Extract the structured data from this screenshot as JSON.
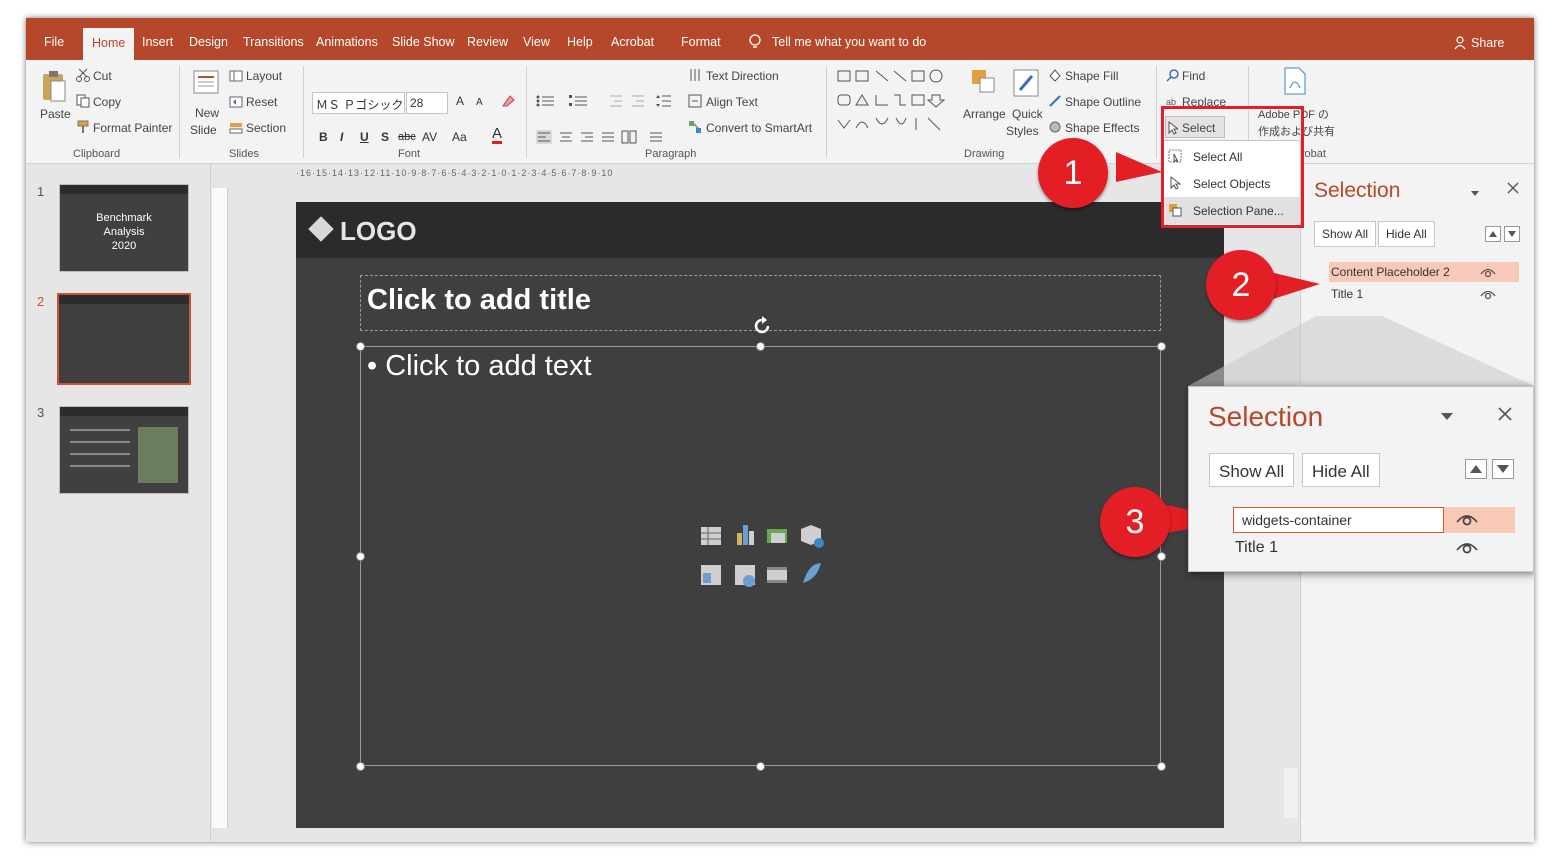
{
  "tabs": [
    "File",
    "Home",
    "Insert",
    "Design",
    "Transitions",
    "Animations",
    "Slide Show",
    "Review",
    "View",
    "Help",
    "Acrobat",
    "Format"
  ],
  "active_tab": "Home",
  "tell_me": "Tell me what you want to do",
  "share": "Share",
  "clipboard": {
    "paste": "Paste",
    "cut": "Cut",
    "copy": "Copy",
    "format_painter": "Format Painter",
    "label": "Clipboard"
  },
  "slides_group": {
    "new": "New",
    "slide": "Slide",
    "layout": "Layout",
    "reset": "Reset",
    "section": "Section",
    "label": "Slides"
  },
  "font": {
    "name": "ＭＳ Ｐゴシック (I",
    "size": "28",
    "label": "Font"
  },
  "paragraph": {
    "text_direction": "Text Direction",
    "align_text": "Align Text",
    "convert": "Convert to SmartArt",
    "label": "Paragraph"
  },
  "drawing": {
    "arrange": "Arrange",
    "quick": "Quick",
    "styles": "Styles",
    "shape_fill": "Shape Fill",
    "shape_outline": "Shape Outline",
    "shape_effects": "Shape Effects",
    "label": "Drawing"
  },
  "editing": {
    "find": "Find",
    "replace": "Replace",
    "select": "Select"
  },
  "acrobat": {
    "line1": "Adobe PDF の",
    "line2": "作成および共有",
    "label": "Acrobat"
  },
  "select_menu": [
    "Select All",
    "Select Objects",
    "Selection Pane..."
  ],
  "thumbnails": [
    {
      "num": "1",
      "line1": "Benchmark",
      "line2": "Analysis",
      "line3": "2020"
    },
    {
      "num": "2"
    },
    {
      "num": "3"
    }
  ],
  "ruler_text": "·16·15·14·13·12·11·10·9·8·7·6·5·4·3·2·1·0·1·2·3·4·5·6·7·8·9·10",
  "slide": {
    "logo": "LOGO",
    "title": "Click to add title",
    "bullet": "• Click to add text"
  },
  "selection_pane": {
    "title": "Selection",
    "show_all": "Show All",
    "hide_all": "Hide All",
    "items": [
      "Content Placeholder 2",
      "Title 1"
    ]
  },
  "zoom_pane": {
    "title": "Selection",
    "show_all": "Show All",
    "hide_all": "Hide All",
    "edit_value": "widgets-container",
    "item2": "Title 1"
  },
  "callouts": [
    "1",
    "2",
    "3"
  ],
  "colors": {
    "accent": "#b7472a",
    "callout": "#e31e24",
    "highlight": "#f8c9b6"
  }
}
